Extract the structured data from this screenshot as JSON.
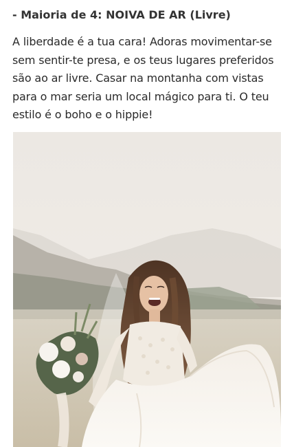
{
  "article": {
    "heading": "- Maioria de 4: NOIVA DE AR (Livre)",
    "paragraph": "A liberdade é a tua cara! Adoras movimentar-se sem sentir-te presa, e os teus lugares preferidos são ao ar livre. Casar na montanha com vistas para o mar seria um local mágico para ti. O teu estilo é o boho e o hippie!",
    "photo": {
      "subject": "smiling-bride-in-meadow-photo"
    }
  },
  "colors": {
    "text": "#2a2a2a",
    "heading": "#333333",
    "sky": "#efebe6",
    "mountain": "#bdb7ae",
    "field": "#d8d0bf",
    "dress": "#f7f4ef",
    "hair": "#6b4a32",
    "bouquet_green": "#5d6b4c"
  }
}
